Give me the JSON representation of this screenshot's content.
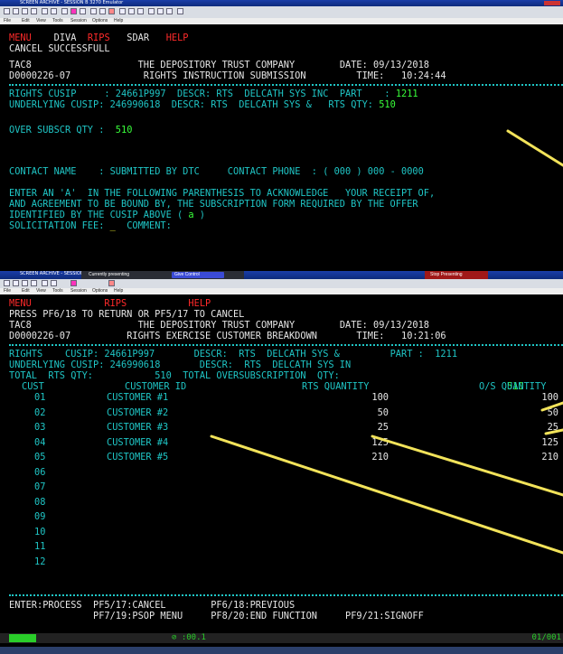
{
  "window1": {
    "title": "SCREEN ARCHIVE - SESSION B 3270 Emulator",
    "menu": [
      "File",
      "Edit",
      "View",
      "Tools",
      "Session",
      "Options",
      "Help"
    ],
    "nav": [
      "MENU",
      "DIVA",
      "RIPS",
      "SDAR",
      "HELP"
    ],
    "status_msg": "CANCEL SUCCESSFULL",
    "tac": "TAC8",
    "company": "THE DEPOSITORY TRUST COMPANY",
    "date_label": "DATE:",
    "date": "09/13/2018",
    "acct": "D0000226-07",
    "screen_title": "RIGHTS INSTRUCTION SUBMISSION",
    "time_label": "TIME:",
    "time": "10:24:44",
    "rights_cusip_label": "RIGHTS CUSIP     :",
    "rights_cusip": "24661P997",
    "descr_label": "DESCR:",
    "rights_descr": "RTS  DELCATH SYS INC",
    "part_label": "PART    :",
    "part": "1211",
    "underlying_label": "UNDERLYING CUSIP:",
    "underlying_cusip": "246990618",
    "underlying_descr": "RTS  DELCATH SYS &",
    "rts_qty_label": "RTS QTY:",
    "rts_qty": "510",
    "over_label": "OVER SUBSCR QTY :",
    "over_qty": "510",
    "contact_name_label": "CONTACT NAME    :",
    "contact_name": "SUBMITTED BY DTC",
    "contact_phone_label": "CONTACT PHONE  :",
    "contact_phone": "( 000 ) 000 - 0000",
    "ack_line1": "ENTER AN 'A'  IN THE FOLLOWING PARENTHESIS TO ACKNOWLEDGE   YOUR RECEIPT OF,",
    "ack_line2": "AND AGREEMENT TO BE BOUND BY, THE SUBSCRIPTION FORM REQUIRED BY THE OFFER",
    "ack_line3_prefix": "IDENTIFIED BY THE CUSIP ABOVE (",
    "ack_value": " a ",
    "ack_line3_suffix": ")",
    "solicit_label": "SOLICITATION FEE:",
    "solicit_value": "_",
    "comment_label": "COMMENT:"
  },
  "window2": {
    "title": "SCREEN ARCHIVE - SESSION B",
    "presenting": "Currently presenting",
    "give_control": "Give Control",
    "stop_presenting": "Stop Presenting",
    "menu": [
      "File",
      "Edit",
      "View",
      "Tools",
      "Session",
      "Options",
      "Help"
    ],
    "nav": [
      "MENU",
      "RIPS",
      "HELP"
    ],
    "instructions": "PRESS PF6/18 TO RETURN OR PF5/17 TO CANCEL",
    "tac": "TAC8",
    "company": "THE DEPOSITORY TRUST COMPANY",
    "date_label": "DATE:",
    "date": "09/13/2018",
    "acct": "D0000226-07",
    "screen_title": "RIGHTS EXERCISE CUSTOMER BREAKDOWN",
    "time_label": "TIME:",
    "time": "10:21:06",
    "rights_label": "RIGHTS    CUSIP:",
    "rights_cusip": "24661P997",
    "descr_label": "DESCR:",
    "rights_descr": "RTS  DELCATH SYS &",
    "part_label": "PART :",
    "part": "1211",
    "underlying_label": "UNDERLYING CUSIP:",
    "underlying_cusip": "246990618",
    "underlying_descr": "RTS  DELCATH SYS IN",
    "total_label": "TOTAL  RTS QTY:",
    "total_rts": "510",
    "total_over_label": "TOTAL OVERSUBSCRIPTION  QTY:",
    "total_over": "510",
    "col_cust": "CUST",
    "col_id": "CUSTOMER ID",
    "col_rts": "RTS QUANTITY",
    "col_os": "O/S QUANTITY",
    "rows": [
      {
        "cust": "01",
        "id": "CUSTOMER #1",
        "rts": "100",
        "os": "100"
      },
      {
        "cust": "02",
        "id": "CUSTOMER #2",
        "rts": "50",
        "os": "50"
      },
      {
        "cust": "03",
        "id": "CUSTOMER #3",
        "rts": "25",
        "os": "25"
      },
      {
        "cust": "04",
        "id": "CUSTOMER #4",
        "rts": "125",
        "os": "125"
      },
      {
        "cust": "05",
        "id": "CUSTOMER #5",
        "rts": "210",
        "os": "210"
      },
      {
        "cust": "06",
        "id": "",
        "rts": "",
        "os": ""
      },
      {
        "cust": "07",
        "id": "",
        "rts": "",
        "os": ""
      },
      {
        "cust": "08",
        "id": "",
        "rts": "",
        "os": ""
      },
      {
        "cust": "09",
        "id": "",
        "rts": "",
        "os": ""
      },
      {
        "cust": "10",
        "id": "",
        "rts": "",
        "os": ""
      },
      {
        "cust": "11",
        "id": "",
        "rts": "",
        "os": ""
      },
      {
        "cust": "12",
        "id": "",
        "rts": "",
        "os": ""
      }
    ],
    "pf_enter": "ENTER:PROCESS",
    "pf5": "PF5/17:CANCEL",
    "pf6": "PF6/18:PREVIOUS",
    "pf7": "PF7/19:PSOP MENU",
    "pf8": "PF8/20:END FUNCTION",
    "pf9": "PF9/21:SIGNOFF",
    "status_cursor": "⊘ :00.1",
    "status_pos": "01/001"
  },
  "colors": {
    "screen_bg": "#000000",
    "cyan": "#1fc6c6",
    "red": "#ff2a2a",
    "green": "#39ff3a",
    "yellow": "#e9e92a",
    "arrow": "#f2e35a"
  }
}
